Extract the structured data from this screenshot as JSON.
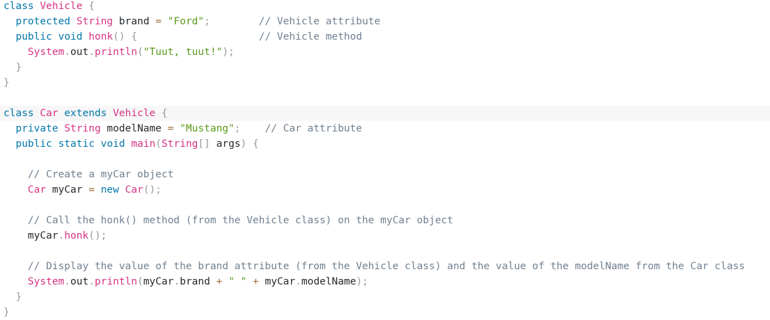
{
  "editor": {
    "language": "java",
    "colors": {
      "keyword": "#0077aa",
      "type": "#d63384",
      "function": "#d63384",
      "string": "#5a9a1a",
      "comment": "#708090",
      "punctuation": "#999999",
      "operator": "#9a6e3a",
      "identifier": "#24292e",
      "highlight_line_bg": "#f7f7f7"
    },
    "lines": [
      [
        {
          "t": "class",
          "c": "kw"
        },
        {
          "t": " ",
          "c": "id"
        },
        {
          "t": "Vehicle",
          "c": "ty"
        },
        {
          "t": " ",
          "c": "id"
        },
        {
          "t": "{",
          "c": "pn"
        }
      ],
      [
        {
          "t": "  ",
          "c": "id"
        },
        {
          "t": "protected",
          "c": "kw"
        },
        {
          "t": " ",
          "c": "id"
        },
        {
          "t": "String",
          "c": "ty"
        },
        {
          "t": " brand ",
          "c": "id"
        },
        {
          "t": "=",
          "c": "op"
        },
        {
          "t": " ",
          "c": "id"
        },
        {
          "t": "\"Ford\"",
          "c": "str"
        },
        {
          "t": ";",
          "c": "pn"
        },
        {
          "t": "        ",
          "c": "id"
        },
        {
          "t": "// Vehicle attribute",
          "c": "cm"
        }
      ],
      [
        {
          "t": "  ",
          "c": "id"
        },
        {
          "t": "public",
          "c": "kw"
        },
        {
          "t": " ",
          "c": "id"
        },
        {
          "t": "void",
          "c": "kw"
        },
        {
          "t": " ",
          "c": "id"
        },
        {
          "t": "honk",
          "c": "fn"
        },
        {
          "t": "()",
          "c": "pn"
        },
        {
          "t": " ",
          "c": "id"
        },
        {
          "t": "{",
          "c": "pn"
        },
        {
          "t": "                    ",
          "c": "id"
        },
        {
          "t": "// Vehicle method",
          "c": "cm"
        }
      ],
      [
        {
          "t": "    ",
          "c": "id"
        },
        {
          "t": "System",
          "c": "ty"
        },
        {
          "t": ".",
          "c": "pn"
        },
        {
          "t": "out",
          "c": "id"
        },
        {
          "t": ".",
          "c": "pn"
        },
        {
          "t": "println",
          "c": "fn"
        },
        {
          "t": "(",
          "c": "pn"
        },
        {
          "t": "\"Tuut, tuut!\"",
          "c": "str"
        },
        {
          "t": ");",
          "c": "pn"
        }
      ],
      [
        {
          "t": "  ",
          "c": "id"
        },
        {
          "t": "}",
          "c": "pn"
        }
      ],
      [
        {
          "t": "}",
          "c": "pn"
        }
      ],
      [],
      [
        {
          "t": "class",
          "c": "kw"
        },
        {
          "t": " ",
          "c": "id"
        },
        {
          "t": "Car",
          "c": "ty"
        },
        {
          "t": " ",
          "c": "id"
        },
        {
          "t": "extends",
          "c": "kw"
        },
        {
          "t": " ",
          "c": "id"
        },
        {
          "t": "Vehicle",
          "c": "ty"
        },
        {
          "t": " ",
          "c": "id"
        },
        {
          "t": "{",
          "c": "pn"
        }
      ],
      [
        {
          "t": "  ",
          "c": "id"
        },
        {
          "t": "private",
          "c": "kw"
        },
        {
          "t": " ",
          "c": "id"
        },
        {
          "t": "String",
          "c": "ty"
        },
        {
          "t": " modelName ",
          "c": "id"
        },
        {
          "t": "=",
          "c": "op"
        },
        {
          "t": " ",
          "c": "id"
        },
        {
          "t": "\"Mustang\"",
          "c": "str"
        },
        {
          "t": ";",
          "c": "pn"
        },
        {
          "t": "    ",
          "c": "id"
        },
        {
          "t": "// Car attribute",
          "c": "cm"
        }
      ],
      [
        {
          "t": "  ",
          "c": "id"
        },
        {
          "t": "public",
          "c": "kw"
        },
        {
          "t": " ",
          "c": "id"
        },
        {
          "t": "static",
          "c": "kw"
        },
        {
          "t": " ",
          "c": "id"
        },
        {
          "t": "void",
          "c": "kw"
        },
        {
          "t": " ",
          "c": "id"
        },
        {
          "t": "main",
          "c": "fn"
        },
        {
          "t": "(",
          "c": "pn"
        },
        {
          "t": "String",
          "c": "ty"
        },
        {
          "t": "[]",
          "c": "pn"
        },
        {
          "t": " args",
          "c": "id"
        },
        {
          "t": ")",
          "c": "pn"
        },
        {
          "t": " ",
          "c": "id"
        },
        {
          "t": "{",
          "c": "pn"
        }
      ],
      [],
      [
        {
          "t": "    ",
          "c": "id"
        },
        {
          "t": "// Create a myCar object",
          "c": "cm"
        }
      ],
      [
        {
          "t": "    ",
          "c": "id"
        },
        {
          "t": "Car",
          "c": "ty"
        },
        {
          "t": " myCar ",
          "c": "id"
        },
        {
          "t": "=",
          "c": "op"
        },
        {
          "t": " ",
          "c": "id"
        },
        {
          "t": "new",
          "c": "kw"
        },
        {
          "t": " ",
          "c": "id"
        },
        {
          "t": "Car",
          "c": "fn"
        },
        {
          "t": "();",
          "c": "pn"
        }
      ],
      [],
      [
        {
          "t": "    ",
          "c": "id"
        },
        {
          "t": "// Call the honk() method (from the Vehicle class) on the myCar object",
          "c": "cm"
        }
      ],
      [
        {
          "t": "    ",
          "c": "id"
        },
        {
          "t": "myCar",
          "c": "id"
        },
        {
          "t": ".",
          "c": "pn"
        },
        {
          "t": "honk",
          "c": "fn"
        },
        {
          "t": "();",
          "c": "pn"
        }
      ],
      [],
      [
        {
          "t": "    ",
          "c": "id"
        },
        {
          "t": "// Display the value of the brand attribute (from the Vehicle class) and the value of the modelName from the Car class",
          "c": "cm"
        }
      ],
      [
        {
          "t": "    ",
          "c": "id"
        },
        {
          "t": "System",
          "c": "ty"
        },
        {
          "t": ".",
          "c": "pn"
        },
        {
          "t": "out",
          "c": "id"
        },
        {
          "t": ".",
          "c": "pn"
        },
        {
          "t": "println",
          "c": "fn"
        },
        {
          "t": "(",
          "c": "pn"
        },
        {
          "t": "myCar",
          "c": "id"
        },
        {
          "t": ".",
          "c": "pn"
        },
        {
          "t": "brand ",
          "c": "id"
        },
        {
          "t": "+",
          "c": "op"
        },
        {
          "t": " ",
          "c": "id"
        },
        {
          "t": "\" \"",
          "c": "str"
        },
        {
          "t": " ",
          "c": "id"
        },
        {
          "t": "+",
          "c": "op"
        },
        {
          "t": " myCar",
          "c": "id"
        },
        {
          "t": ".",
          "c": "pn"
        },
        {
          "t": "modelName",
          "c": "id"
        },
        {
          "t": ");",
          "c": "pn"
        }
      ],
      [
        {
          "t": "  ",
          "c": "id"
        },
        {
          "t": "}",
          "c": "pn"
        }
      ],
      [
        {
          "t": "}",
          "c": "pn"
        }
      ]
    ]
  }
}
